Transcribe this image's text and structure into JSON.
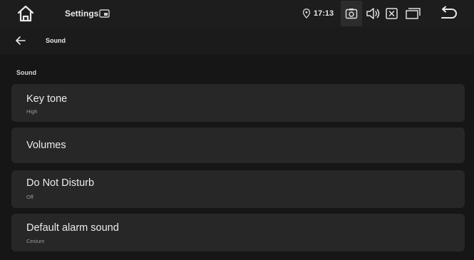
{
  "status_bar": {
    "app_title": "Settings",
    "time": "17:13"
  },
  "app_bar": {
    "title": "Sound"
  },
  "section": {
    "header": "Sound"
  },
  "items": [
    {
      "title": "Key tone",
      "subtitle": "High"
    },
    {
      "title": "Volumes",
      "subtitle": ""
    },
    {
      "title": "Do Not Disturb",
      "subtitle": "Off"
    },
    {
      "title": "Default alarm sound",
      "subtitle": "Cesium"
    }
  ],
  "icons": {
    "home": "home-icon",
    "app_indicator": "app-indicator-icon",
    "location": "location-icon",
    "screenshot": "camera-icon",
    "volume": "speaker-icon",
    "close": "close-box-icon",
    "recents": "recents-icon",
    "back": "return-icon",
    "nav_back": "arrow-left-icon"
  },
  "colors": {
    "background": "#161616",
    "card": "#272727",
    "status_bar": "#1d1d1d"
  }
}
